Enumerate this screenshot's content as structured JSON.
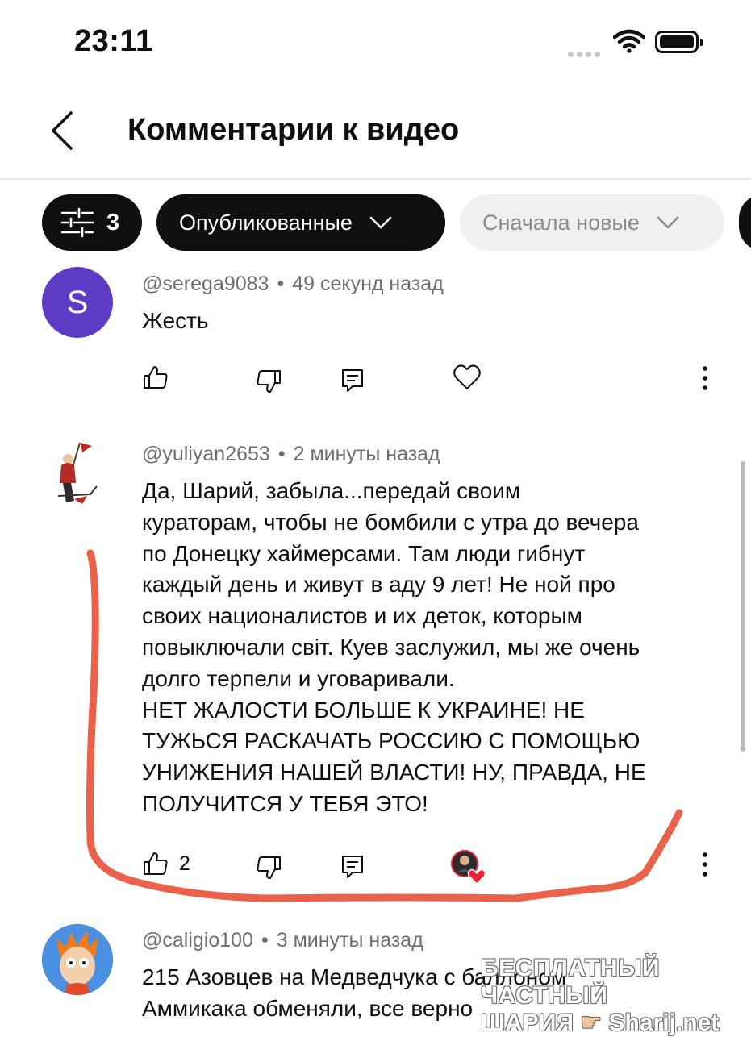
{
  "status_bar": {
    "time": "23:11"
  },
  "header": {
    "title": "Комментарии к видео"
  },
  "chips": {
    "filter_count": "3",
    "published": "Опубликованные",
    "sort": "Сначала новые"
  },
  "comments": [
    {
      "avatar_letter": "S",
      "avatar_color": "#5e3bc4",
      "author": "@serega9083",
      "time": "49 секунд назад",
      "lines": [
        "Жесть"
      ],
      "likes": ""
    },
    {
      "author": "@yuliyan2653",
      "time": "2 минуты назад",
      "lines": [
        "Да, Шарий, забыла...передай своим",
        "кураторам, чтобы не бомбили с утра до вечера",
        "по Донецку хаймерсами. Там люди гибнут",
        "каждый день и живут в аду 9 лет! Не ной про",
        "своих националистов и их деток, которым",
        "повыключали свiт. Куев заслужил, мы же очень",
        "долго терпели и уговаривали.",
        "НЕТ ЖАЛОСТИ БОЛЬШЕ К УКРАИНЕ! НЕ",
        "ТУЖЬСЯ РАСКАЧАТЬ РОССИЮ С ПОМОЩЬЮ",
        "УНИЖЕНИЯ НАШЕЙ ВЛАСТИ! НУ, ПРАВДА, НЕ",
        "ПОЛУЧИТСЯ У ТЕБЯ ЭТО!"
      ],
      "likes": "2"
    },
    {
      "author": "@caligio100",
      "time": "3 минуты назад",
      "lines": [
        "215 Азовцев на Медведчука с баллоном",
        "Аммикака обменяли, все верно"
      ]
    }
  ],
  "watermark": {
    "line1": "БЕСПЛАТНЫЙ ЧАСТНЫЙ",
    "line2_a": "ШАРИЯ",
    "line2_b": "Sharij.net"
  },
  "colors": {
    "annotation": "#e8553a",
    "heart": "#e8233a"
  }
}
